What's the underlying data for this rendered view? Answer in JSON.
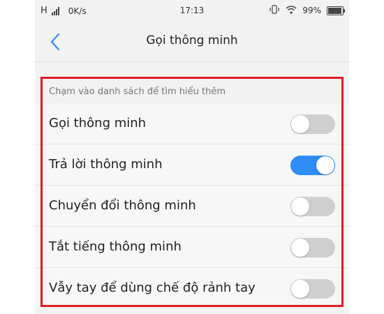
{
  "statusbar": {
    "network": "H",
    "speed": "0K/s",
    "time": "17:13",
    "battery": "99%"
  },
  "header": {
    "title": "Gọi thông minh"
  },
  "section": {
    "caption": "Chạm vào danh sách để tìm hiểu thêm"
  },
  "settings": [
    {
      "label": "Gọi thông minh",
      "enabled": false
    },
    {
      "label": "Trả lời thông minh",
      "enabled": true
    },
    {
      "label": "Chuyển đổi thông minh",
      "enabled": false
    },
    {
      "label": "Tắt tiếng thông minh",
      "enabled": false
    },
    {
      "label": "Vẫy tay để dùng chế độ rảnh tay",
      "enabled": false
    }
  ],
  "colors": {
    "toggle_on": "#2f8df5",
    "toggle_off": "#cfcfcf",
    "highlight": "#e11b22"
  }
}
